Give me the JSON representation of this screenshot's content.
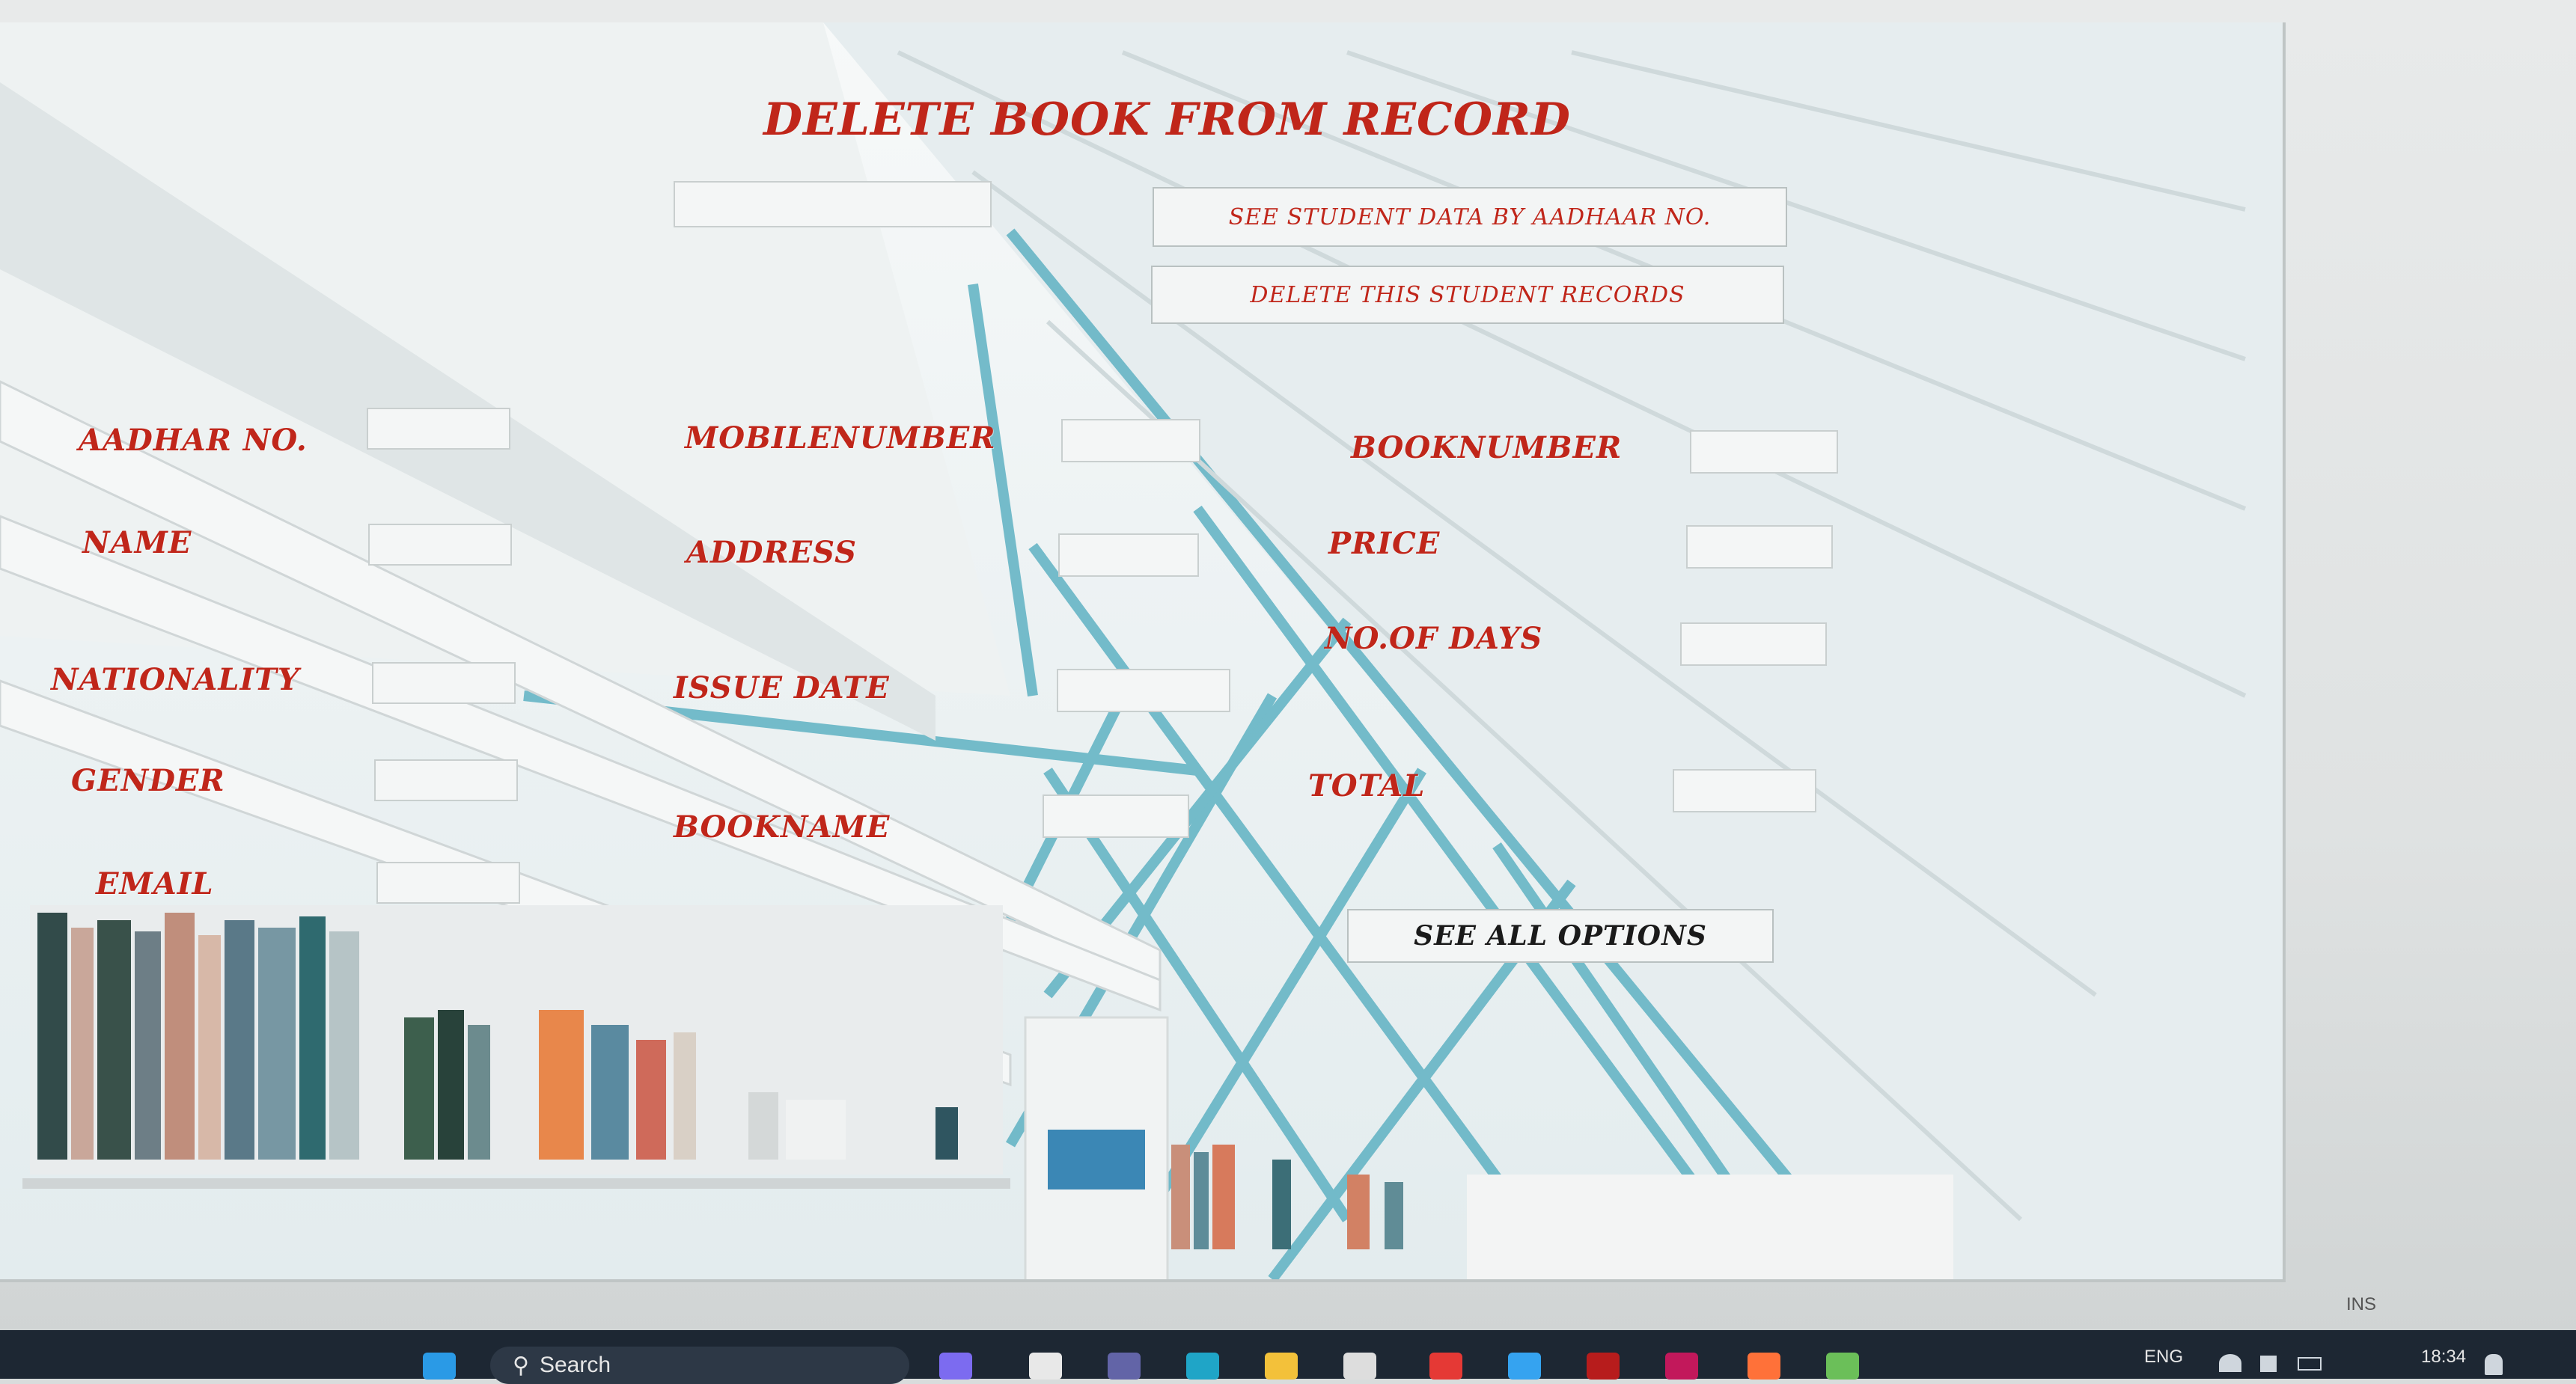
{
  "window": {
    "title": "DELETE BOOK FROM RECORD"
  },
  "search_box": {
    "value": ""
  },
  "buttons": {
    "see_student_data": "SEE STUDENT DATA BY  AADHAAR NO.",
    "delete_records": "DELETE THIS STUDENT RECORDS",
    "see_all_options": "SEE ALL OPTIONS"
  },
  "fields": {
    "aadhar": {
      "label": "AADHAR NO.",
      "value": ""
    },
    "name": {
      "label": "NAME",
      "value": ""
    },
    "nationality": {
      "label": "NATIONALITY",
      "value": ""
    },
    "gender": {
      "label": "GENDER",
      "value": ""
    },
    "email": {
      "label": "EMAIL",
      "value": ""
    },
    "mobile": {
      "label": "MOBILENUMBER",
      "value": ""
    },
    "address": {
      "label": "ADDRESS",
      "value": ""
    },
    "issue_date": {
      "label": "ISSUE DATE",
      "value": ""
    },
    "bookname": {
      "label": "BOOKNAME",
      "value": ""
    },
    "booknumber": {
      "label": "BOOKNUMBER",
      "value": ""
    },
    "price": {
      "label": "PRICE",
      "value": ""
    },
    "days": {
      "label": "NO.OF DAYS",
      "value": ""
    },
    "total": {
      "label": "TOTAL",
      "value": ""
    }
  },
  "status": {
    "ins": "INS"
  },
  "taskbar": {
    "search_label": "Search",
    "language": "ENG",
    "time": "18:34"
  },
  "colors": {
    "label_red": "#c0261a",
    "taskbar_bg": "#1d2733"
  }
}
